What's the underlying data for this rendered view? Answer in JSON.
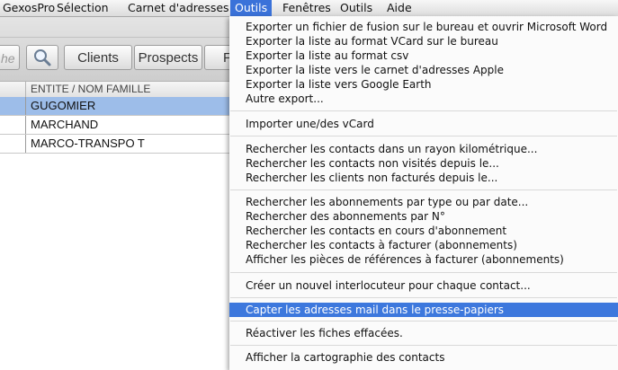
{
  "menubar": {
    "items": [
      "GexosPro",
      "Sélection",
      "Carnet d'adresses",
      "Outils",
      "Fenêtres",
      "Outils",
      "Aide"
    ]
  },
  "toolbar": {
    "search_stub": "he",
    "clients_label": "Clients",
    "prospects_label": "Prospects",
    "more_label": "F"
  },
  "grid": {
    "column_title": "ENTITE / NOM FAMILLE",
    "rows": [
      "GUGOMIER",
      "MARCHAND",
      "MARCO-TRANSPO T"
    ]
  },
  "dropdown": {
    "groups": [
      [
        "Exporter un fichier de fusion sur le bureau et ouvrir Microsoft Word",
        "Exporter la liste au format VCard sur le bureau",
        "Exporter la liste au format csv",
        "Exporter la liste vers le carnet d'adresses Apple",
        "Exporter la liste vers Google Earth",
        "Autre export..."
      ],
      [
        "Importer une/des vCard"
      ],
      [
        "Rechercher les contacts dans un rayon kilométrique...",
        "Rechercher les contacts non visités depuis le...",
        "Rechercher les clients non facturés depuis le..."
      ],
      [
        "Rechercher les abonnements par type ou par date...",
        "Rechercher des abonnements par N°",
        "Rechercher les contacts en cours d'abonnement",
        "Rechercher les contacts à facturer (abonnements)",
        "Afficher les pièces de références à facturer (abonnements)"
      ],
      [
        "Créer un nouvel interlocuteur pour chaque contact..."
      ],
      [
        "Capter les adresses mail dans le presse-papiers"
      ],
      [
        "Réactiver les fiches effacées."
      ],
      [
        "Afficher la cartographie des contacts"
      ]
    ],
    "highlighted_item": "Capter les adresses mail dans le presse-papiers"
  }
}
